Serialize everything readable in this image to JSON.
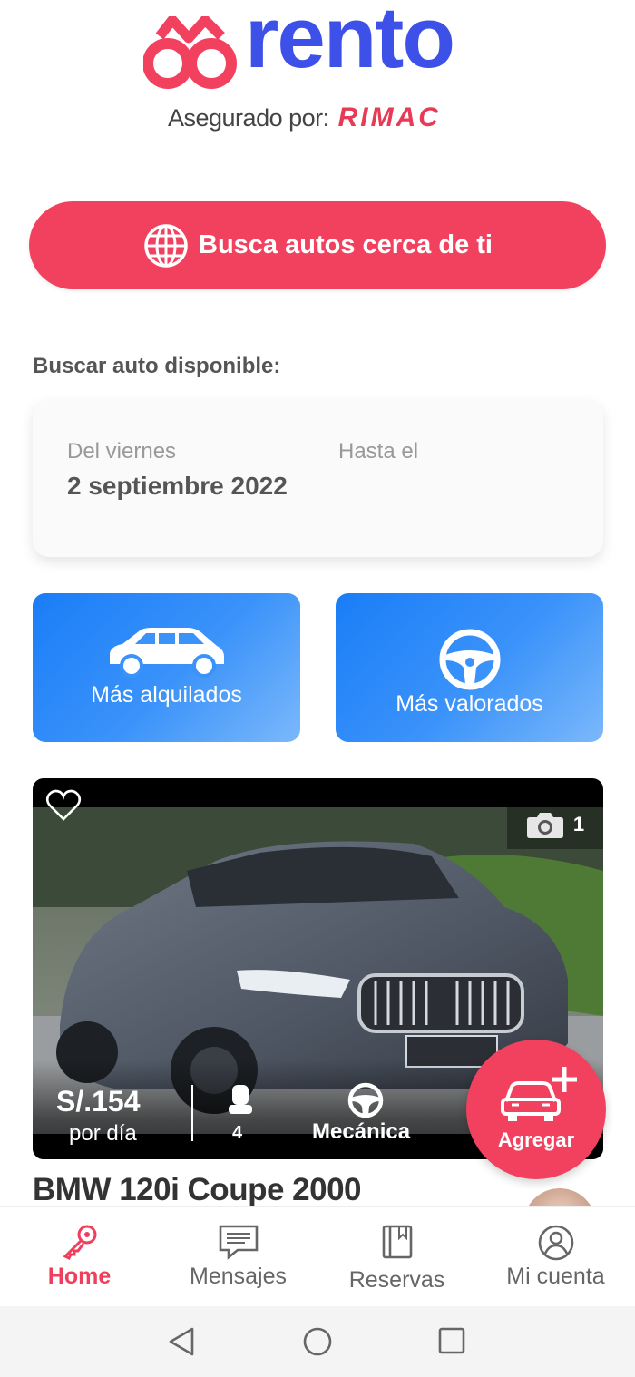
{
  "header": {
    "logo_text": "rento",
    "insured_label": "Asegurado por:",
    "insurer_name": "RIMAC"
  },
  "search": {
    "button_label": "Busca autos cerca de ti",
    "icon": "globe-icon"
  },
  "availability": {
    "section_label": "Buscar auto disponible:",
    "from_label": "Del viernes",
    "from_value": "2 septiembre 2022",
    "to_label": "Hasta el"
  },
  "filters": [
    {
      "label": "Más alquilados",
      "icon": "car-icon"
    },
    {
      "label": "Más valorados",
      "icon": "steering-wheel-icon"
    }
  ],
  "listing": {
    "photo_count": "1",
    "price": "S/.154",
    "per_day": "por día",
    "seats": "4",
    "transmission": "Mecánica",
    "title": "BMW 120i Coupe 2000"
  },
  "fab": {
    "label": "Agregar"
  },
  "bottom_nav": [
    {
      "label": "Home",
      "icon": "key-icon",
      "active": true
    },
    {
      "label": "Mensajes",
      "icon": "message-icon",
      "active": false
    },
    {
      "label": "Reservas",
      "icon": "book-icon",
      "active": false
    },
    {
      "label": "Mi cuenta",
      "icon": "user-icon",
      "active": false
    }
  ],
  "colors": {
    "brand_blue": "#3d51e8",
    "brand_red": "#f2415f",
    "tile_blue": "#1a7df7"
  }
}
